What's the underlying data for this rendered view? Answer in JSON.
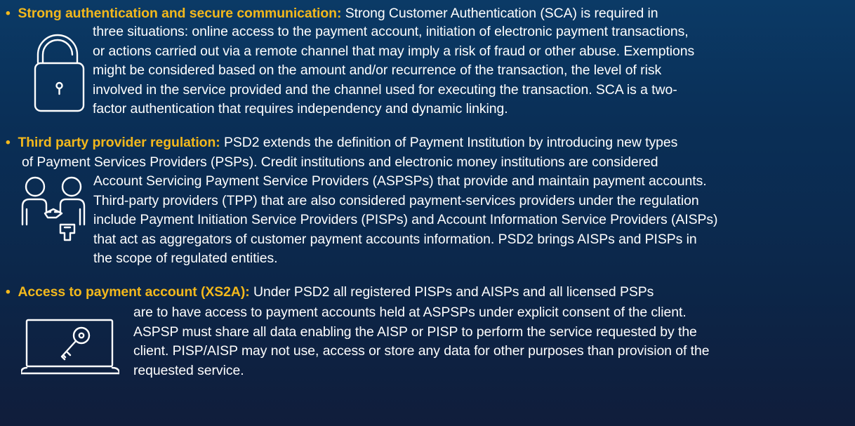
{
  "accent_color": "#f3b81c",
  "sections": [
    {
      "bullet": "•",
      "title": "Strong authentication and secure communication:",
      "icon": "padlock-icon",
      "lines": [
        "Strong Customer Authentication (SCA) is required in",
        "three situations: online access to the payment account, initiation of electronic payment transactions,",
        "or actions carried out via a remote channel that may imply a risk of fraud or other abuse. Exemptions",
        "might be considered based on the amount and/or recurrence of the transaction, the level of risk",
        "involved in the service provided and the channel used for executing the transaction. SCA is a two-",
        "factor authentication that requires independency and dynamic linking."
      ]
    },
    {
      "bullet": "•",
      "title": "Third party provider regulation:",
      "icon": "handshake-icon",
      "lines": [
        "PSD2 extends the definition of Payment Institution by introducing new types",
        "of Payment Services Providers (PSPs). Credit institutions and electronic money institutions are considered",
        "Account Servicing Payment Service Providers (ASPSPs) that provide and maintain payment accounts.",
        "Third-party providers (TPP) that are also considered payment-services providers under the regulation",
        "include Payment Initiation Service Providers (PISPs) and Account Information Service Providers (AISPs)",
        "that act as aggregators of customer payment accounts information. PSD2 brings AISPs and PISPs in",
        "the scope of regulated entities."
      ]
    },
    {
      "bullet": "•",
      "title": "Access to payment account (XS2A):",
      "icon": "laptop-key-icon",
      "lines": [
        "Under PSD2 all registered PISPs and AISPs and all licensed PSPs",
        "are to have access to payment accounts held at ASPSPs under explicit consent of the client.",
        "ASPSP must share all data enabling the AISP or PISP to perform the service requested by the",
        "client. PISP/AISP may not use, access or store any data for other purposes than provision of the",
        "requested service."
      ]
    }
  ]
}
